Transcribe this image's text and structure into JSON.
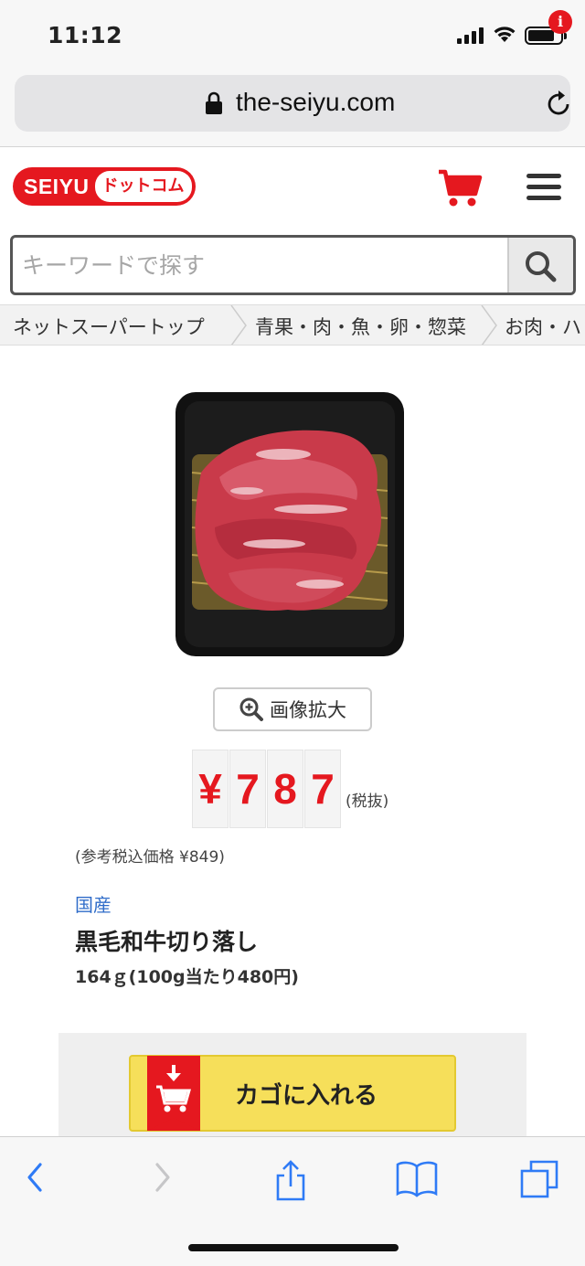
{
  "status_bar": {
    "time": "11:12"
  },
  "browser": {
    "url": "the-seiyu.com"
  },
  "header": {
    "logo_main": "SEIYU",
    "logo_sub": "ドットコム",
    "notification_badge": "i"
  },
  "search": {
    "placeholder": "キーワードで探す"
  },
  "breadcrumb": [
    "ネットスーパートップ",
    "青果・肉・魚・卵・惣菜",
    "お肉・ハ"
  ],
  "product": {
    "zoom_label": "画像拡大",
    "price_digits": [
      "¥",
      "7",
      "8",
      "7"
    ],
    "tax_label": "(税抜)",
    "reference_price": "(参考税込価格 ¥849)",
    "origin": "国産",
    "name": "黒毛和牛切り落し",
    "weight": "164ｇ(100g当たり480円)",
    "add_to_cart": "カゴに入れる"
  },
  "colors": {
    "brand_red": "#e5181f",
    "button_yellow": "#f6df5a",
    "link_blue": "#2f6cc9",
    "browser_blue": "#2f7bf6"
  }
}
